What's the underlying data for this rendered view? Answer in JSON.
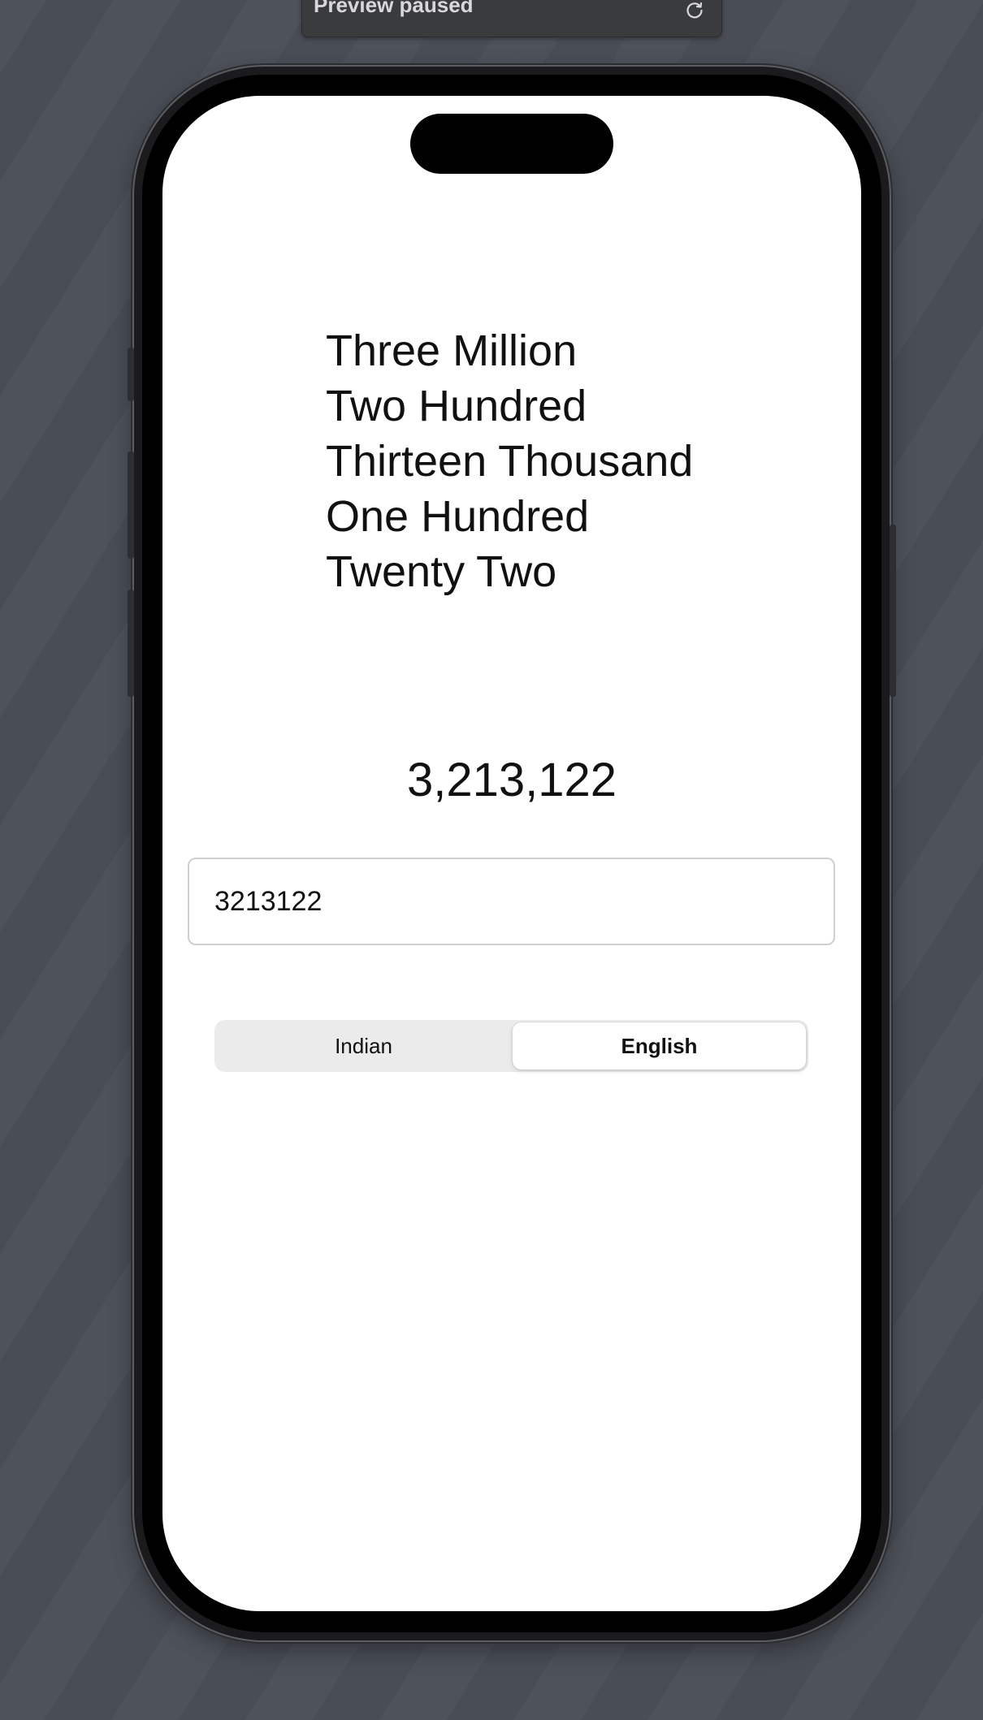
{
  "preview_banner": {
    "label": "Preview paused",
    "icon": "refresh-icon"
  },
  "screen": {
    "words_lines": [
      "Three Million",
      "Two Hundred",
      "Thirteen Thousand",
      "One Hundred",
      "Twenty Two"
    ],
    "formatted_number": "3,213,122",
    "input": {
      "value": "3213122"
    },
    "segmented_control": {
      "options": [
        "Indian",
        "English"
      ],
      "selected": "English"
    }
  }
}
